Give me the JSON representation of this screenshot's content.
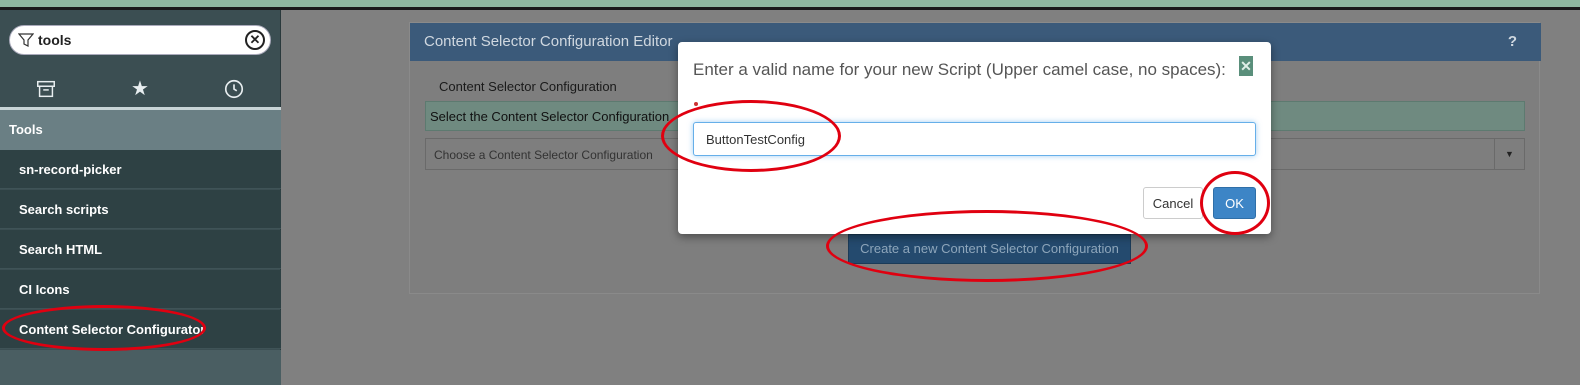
{
  "colors": {
    "annotation": "#e00010",
    "primary_button": "#3d85c6",
    "panel_header": "#3b5a7a",
    "sidebar": "#2e4144"
  },
  "sidebar": {
    "filter_value": "tools",
    "filter_icon": "filter-icon",
    "clear_icon": "clear-circle-icon",
    "nav_icons": [
      "archive-icon",
      "star-icon",
      "clock-icon"
    ],
    "section_title": "Tools",
    "items": [
      {
        "label": "sn-record-picker"
      },
      {
        "label": "Search scripts"
      },
      {
        "label": "Search HTML"
      },
      {
        "label": "CI Icons"
      },
      {
        "label": "Content Selector Configurator"
      }
    ]
  },
  "panel": {
    "title": "Content Selector Configuration Editor",
    "help": "?",
    "config_label": "Content Selector Configuration",
    "select_hint": "Select the Content Selector Configuration",
    "dropdown_placeholder": "Choose a Content Selector Configuration",
    "create_button": "Create a new Content Selector Configuration"
  },
  "modal": {
    "title": "Enter a valid name for your new Script (Upper camel case, no spaces):",
    "close_icon": "close-icon",
    "input_value": "ButtonTestConfig",
    "cancel_label": "Cancel",
    "ok_label": "OK"
  }
}
